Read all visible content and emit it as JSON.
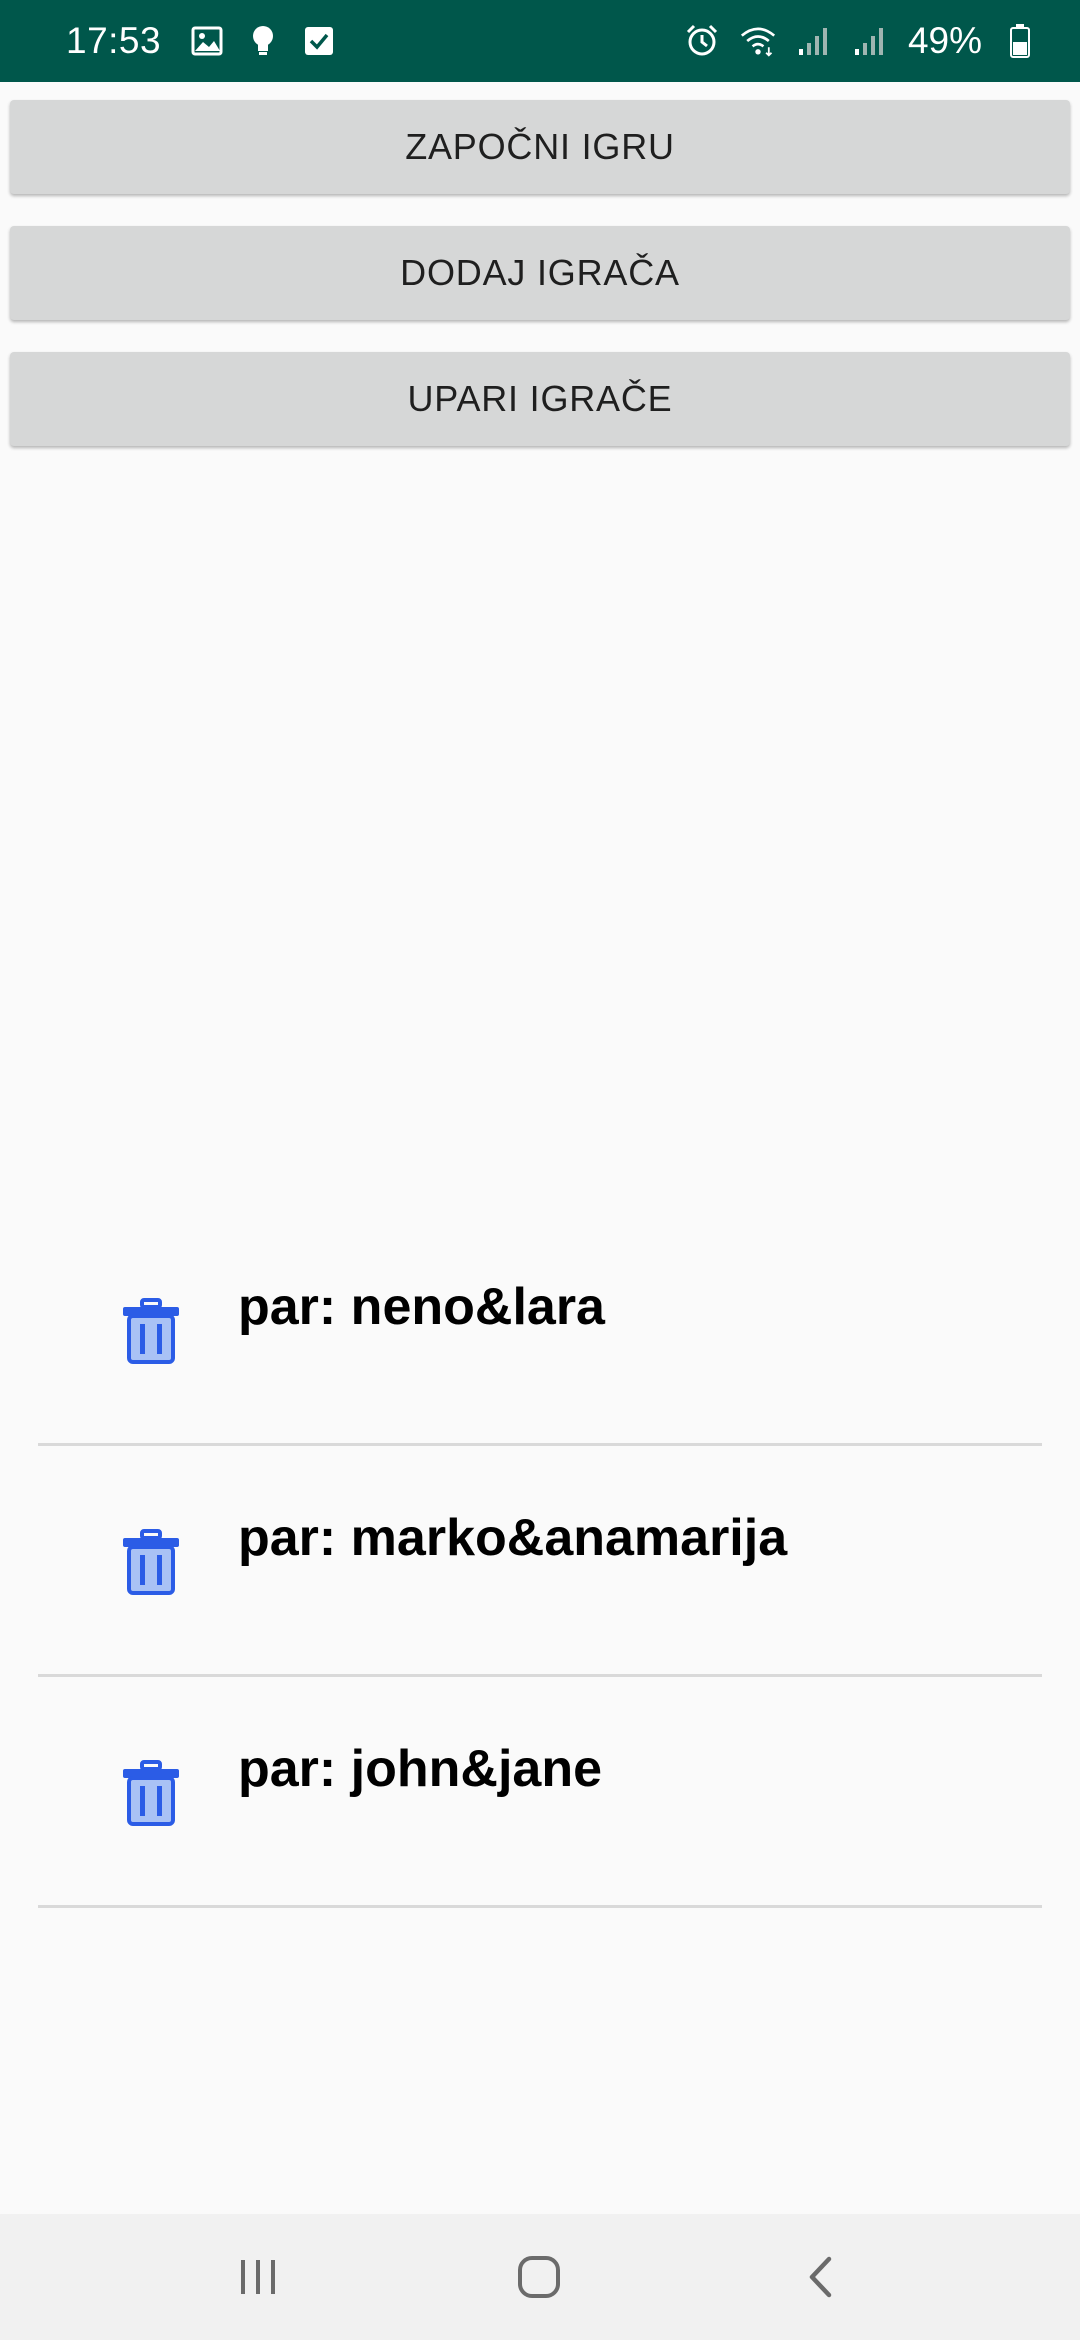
{
  "status_bar": {
    "time": "17:53",
    "battery_percent": "49%",
    "icons_left": [
      "image-icon",
      "lightbulb-icon",
      "checkbox-icon"
    ],
    "icons_right": [
      "alarm-icon",
      "wifi-icon",
      "signal-icon",
      "signal-icon",
      "battery-icon"
    ]
  },
  "buttons": {
    "start_game": "ZAPOČNI IGRU",
    "add_player": "DODAJ IGRAČA",
    "pair_players": "UPARI IGRAČE"
  },
  "pairs": [
    {
      "label": "par: neno&lara"
    },
    {
      "label": "par: marko&anamarija"
    },
    {
      "label": "par: john&jane"
    }
  ],
  "colors": {
    "status_bar": "#00574b",
    "button_bg": "#d6d7d7",
    "trash_icon": "#2b5ce6",
    "trash_fill": "#a9c2f5"
  },
  "nav_bar": {
    "buttons": [
      "recents-icon",
      "home-icon",
      "back-icon"
    ]
  }
}
